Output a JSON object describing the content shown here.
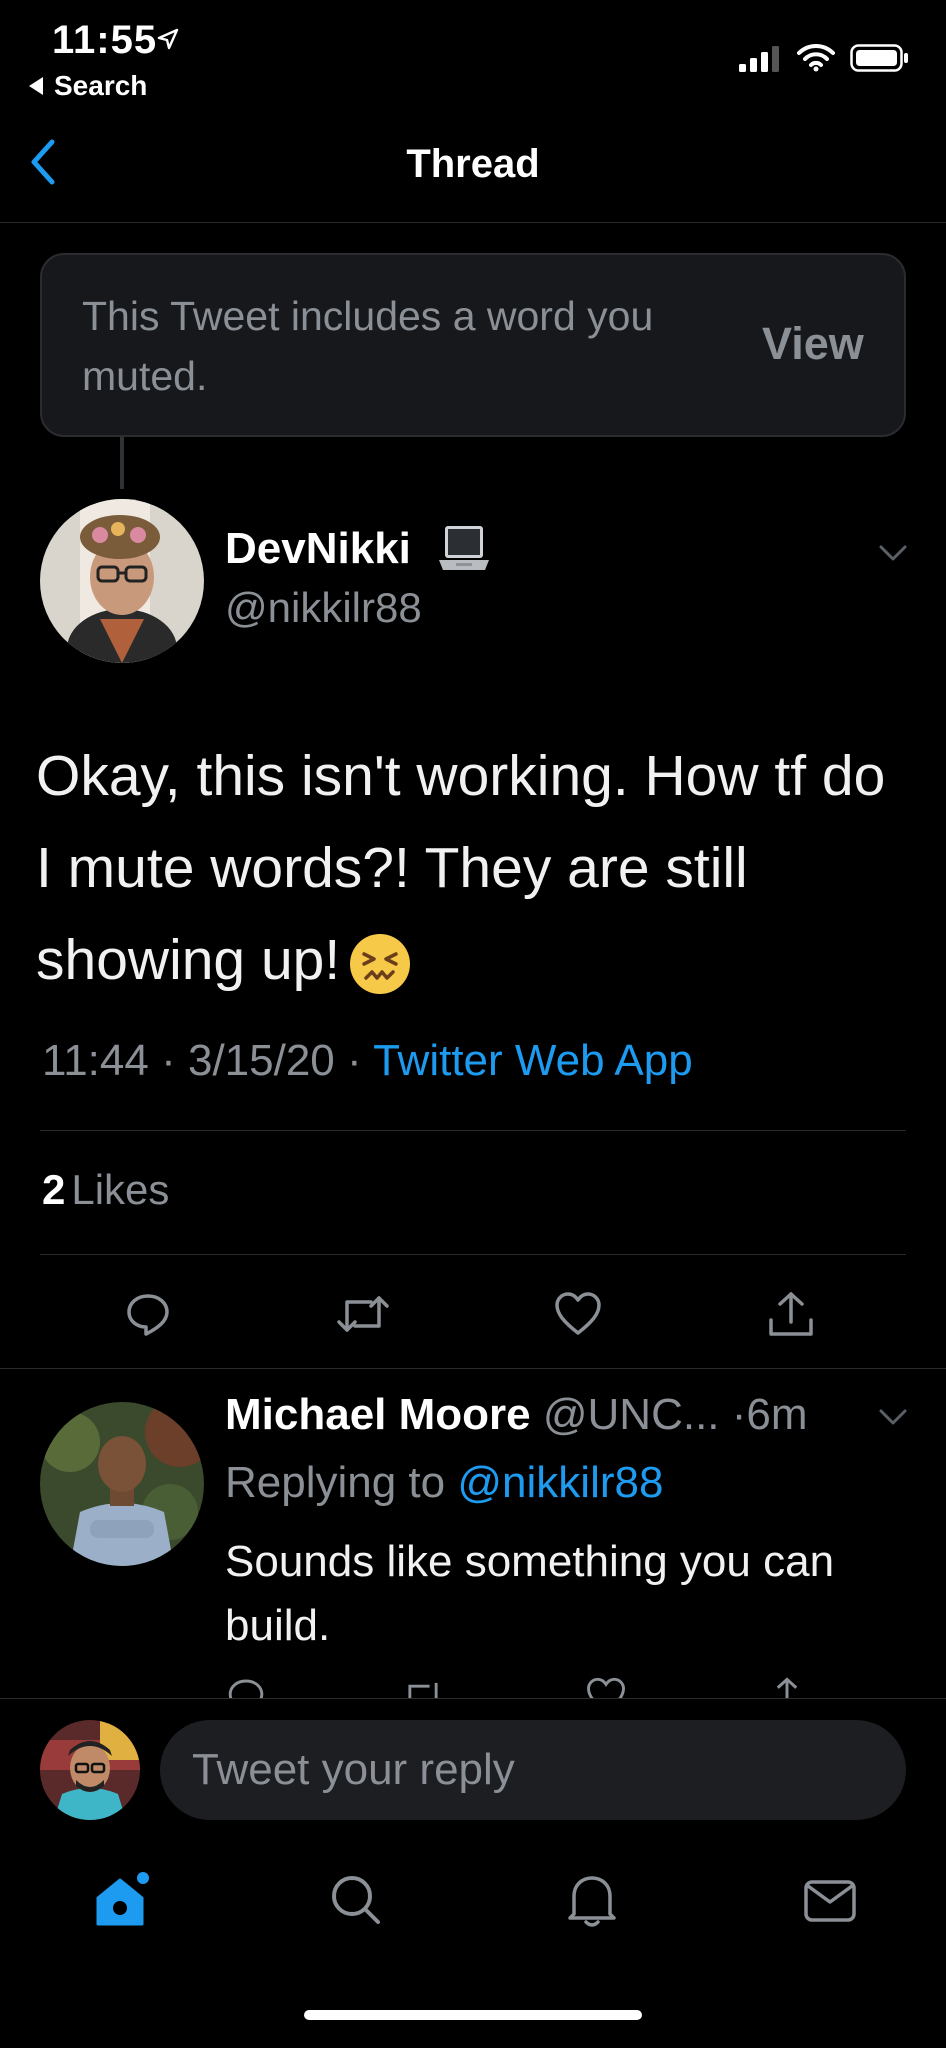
{
  "status_bar": {
    "time": "11:55",
    "back_app": "Search"
  },
  "nav": {
    "title": "Thread"
  },
  "muted_notice": {
    "text": "This Tweet includes a word you muted.",
    "action": "View"
  },
  "tweet": {
    "author_name": "DevNikki",
    "author_handle": "@nikkilr88",
    "text": "Okay, this isn't working. How tf do I mute words?! They are still showing up!",
    "time": "11:44",
    "date": "3/15/20",
    "source": "Twitter Web App",
    "likes_count": "2",
    "likes_label": "Likes"
  },
  "reply": {
    "author_name": "Michael Moore",
    "author_handle": "@UNC...",
    "time": "6m",
    "replying_to_label": "Replying to",
    "replying_to_handle": "@nikkilr88",
    "text": "Sounds like something you can build."
  },
  "composer": {
    "placeholder": "Tweet your reply"
  },
  "colors": {
    "accent": "#1d9bf0",
    "secondary_text": "#8b9096",
    "background": "#000000"
  },
  "icons": [
    "location-arrow-icon",
    "signal-icon",
    "wifi-icon",
    "battery-icon",
    "chevron-left-icon",
    "laptop-icon",
    "chevron-down-icon",
    "reply-icon",
    "retweet-icon",
    "like-icon",
    "share-icon",
    "home-icon",
    "search-icon",
    "notifications-icon",
    "messages-icon"
  ]
}
